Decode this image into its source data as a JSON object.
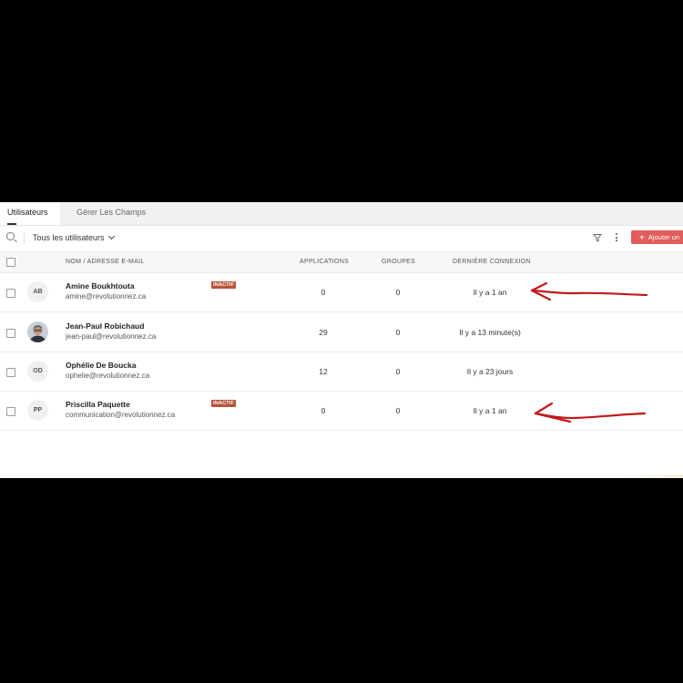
{
  "tabs": [
    {
      "label": "Utilisateurs",
      "active": true
    },
    {
      "label": "Gérer Les Champs",
      "active": false
    }
  ],
  "toolbar": {
    "search_icon": "search-icon",
    "filter_label": "Tous les utilisateurs",
    "filter_icon": "funnel-icon",
    "more_icon": "more-vertical-icon",
    "add_button_label": "Ajouter un"
  },
  "table": {
    "headers": [
      "NOM / ADRESSE E-MAIL",
      "APPLICATIONS",
      "GROUPES",
      "DERNIÈRE CONNEXION"
    ],
    "rows": [
      {
        "initials": "AB",
        "name": "Amine Boukhtouta",
        "email": "amine@revolutionnez.ca",
        "badge": "INACTIF",
        "applications": "0",
        "groupes": "0",
        "last_login": "Il y a 1 an"
      },
      {
        "initials": "",
        "photo": true,
        "name": "Jean-Paul Robichaud",
        "email": "jean-paul@revolutionnez.ca",
        "badge": "",
        "applications": "29",
        "groupes": "0",
        "last_login": "Il y a 13 minute(s)"
      },
      {
        "initials": "OD",
        "name": "Ophélie De Boucka",
        "email": "ophelie@revolutionnez.ca",
        "badge": "",
        "applications": "12",
        "groupes": "0",
        "last_login": "Il y a 23 jours"
      },
      {
        "initials": "PP",
        "name": "Priscilla Paquette",
        "email": "communication@revolutionnez.ca",
        "badge": "INACTIF",
        "applications": "0",
        "groupes": "0",
        "last_login": "Il y a 1 an"
      }
    ]
  },
  "colors": {
    "accent": "#e05d5b",
    "badge": "#b7543a",
    "annotation": "#c0191c"
  }
}
